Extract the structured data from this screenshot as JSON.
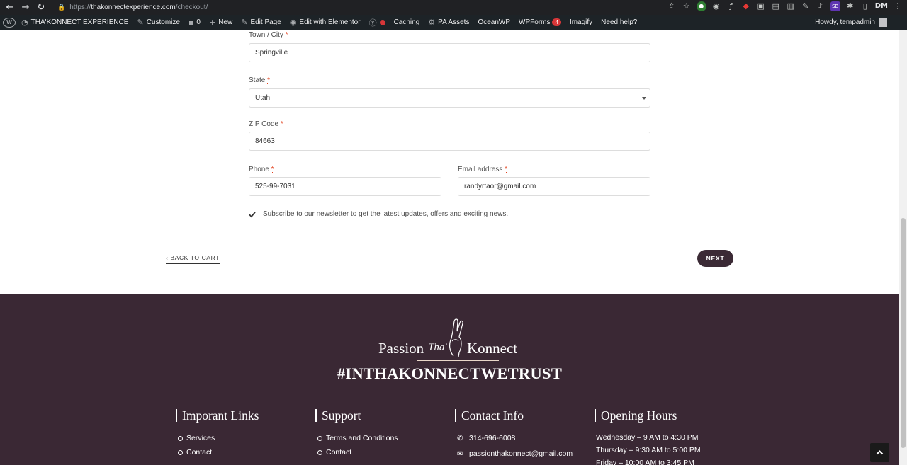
{
  "browser": {
    "url_scheme": "https://",
    "url_host": "thakonnectexperience.com",
    "url_path": "/checkout/",
    "ext_label": "SB",
    "profile_label": "DM"
  },
  "admin_bar": {
    "site_name": "THA'KONNECT EXPERIENCE",
    "customize": "Customize",
    "comments": "0",
    "new": "New",
    "edit_page": "Edit Page",
    "edit_elementor": "Edit with Elementor",
    "caching": "Caching",
    "pa_assets": "PA Assets",
    "oceanwp": "OceanWP",
    "wpforms": "WPForms",
    "wpforms_count": "4",
    "imagify": "Imagify",
    "need_help": "Need help?",
    "howdy": "Howdy, tempadmin"
  },
  "form": {
    "town_label": "Town / City",
    "town_value": "Springville",
    "state_label": "State",
    "state_value": "Utah",
    "zip_label": "ZIP Code",
    "zip_value": "84663",
    "phone_label": "Phone",
    "phone_value": "525-99-7031",
    "email_label": "Email address",
    "email_value": "randyrtaor@gmail.com",
    "required_mark": "*",
    "newsletter_label": "Subscribe to our newsletter to get the latest updates, offers and exciting news.",
    "newsletter_checked": true,
    "back_label": "BACK TO CART",
    "next_label": "NEXT"
  },
  "footer": {
    "logo_left": "Passion",
    "logo_mid": "Tha'",
    "logo_right": "Konnect",
    "hashtag": "#INTHAKONNECTWETRUST",
    "important_links": {
      "title": "Imporant Links",
      "items": [
        "Services",
        "Contact"
      ]
    },
    "support": {
      "title": "Support",
      "items": [
        "Terms and Conditions",
        "Contact"
      ]
    },
    "contact": {
      "title": "Contact Info",
      "phone": "314-696-6008",
      "email": "passionthakonnect@gmail.com"
    },
    "hours": {
      "title": "Opening Hours",
      "items": [
        "Wednesday – 9 AM to 4:30 PM",
        "Thursday – 9:30 AM to 5:00 PM",
        "Friday – 10:00 AM to 3:45 PM"
      ]
    }
  },
  "colors": {
    "footer_bg": "#3a2834",
    "button_bg": "#3b2a35",
    "required": "#e2401c"
  }
}
